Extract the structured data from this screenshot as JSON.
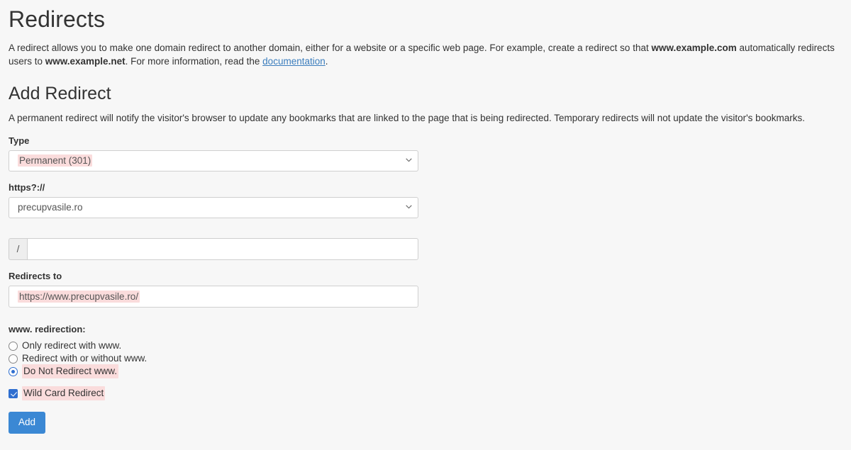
{
  "page": {
    "title": "Redirects",
    "intro_part1": "A redirect allows you to make one domain redirect to another domain, either for a website or a specific web page. For example, create a redirect so that ",
    "intro_bold1": "www.example.com",
    "intro_part2": " automatically redirects users to ",
    "intro_bold2": "www.example.net",
    "intro_part3": ". For more information, read the ",
    "intro_link": "documentation",
    "intro_part4": "."
  },
  "section": {
    "title": "Add Redirect",
    "description": "A permanent redirect will notify the visitor's browser to update any bookmarks that are linked to the page that is being redirected. Temporary redirects will not update the visitor's bookmarks."
  },
  "form": {
    "type": {
      "label": "Type",
      "value": "Permanent (301)",
      "highlighted": true,
      "icon": "chevron-down-icon"
    },
    "domain": {
      "label": "https?://",
      "value": "precupvasile.ro",
      "highlighted": false,
      "icon": "chevron-down-icon"
    },
    "path": {
      "addon": "/",
      "value": "",
      "placeholder": ""
    },
    "redirects_to": {
      "label": "Redirects to",
      "value": "https://www.precupvasile.ro/",
      "highlighted": true
    },
    "www_redirection": {
      "heading": "www. redirection:",
      "options": [
        {
          "label": "Only redirect with www.",
          "checked": false,
          "highlighted": false
        },
        {
          "label": "Redirect with or without www.",
          "checked": false,
          "highlighted": false
        },
        {
          "label": "Do Not Redirect www.",
          "checked": true,
          "highlighted": true
        }
      ]
    },
    "wild_card": {
      "label": "Wild Card Redirect",
      "checked": true,
      "highlighted": true
    },
    "submit": {
      "label": "Add"
    }
  },
  "colors": {
    "page_background": "#f7f7f7",
    "accent_blue": "#3b88d4",
    "link_blue": "#3b7dbd",
    "highlight_pink": "#fadcdc",
    "input_border": "#cfcfcf",
    "text": "#333333"
  }
}
